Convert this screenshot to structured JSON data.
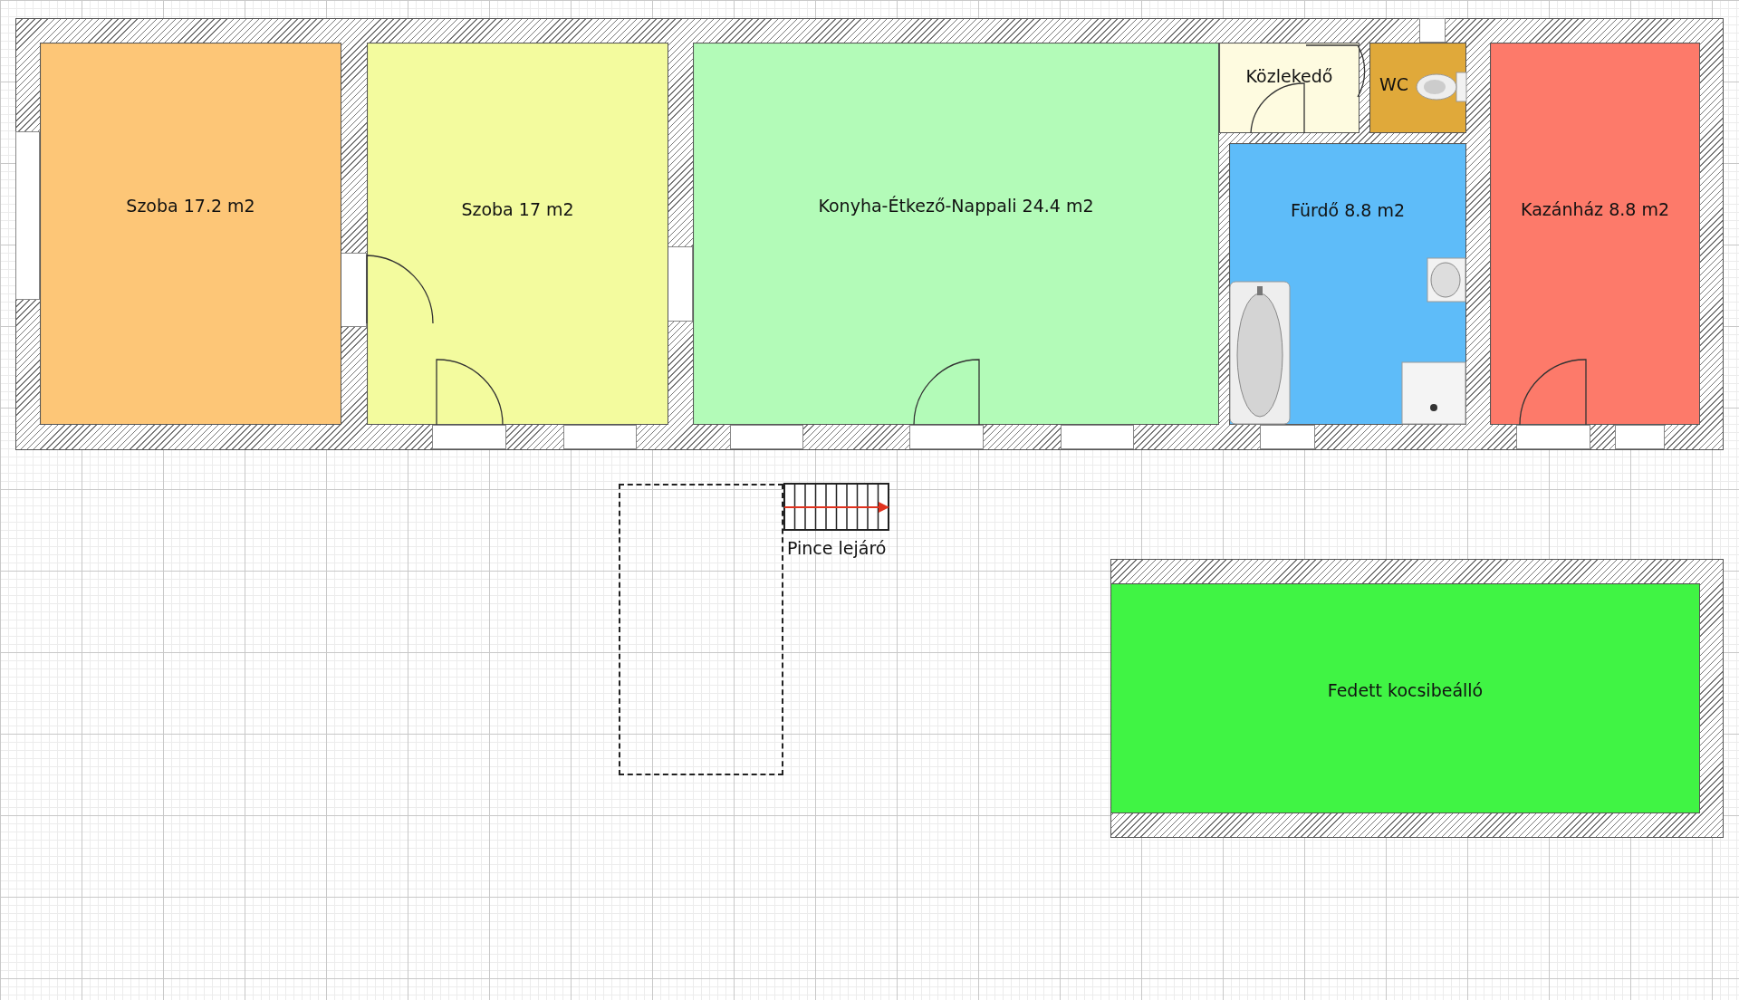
{
  "rooms": [
    {
      "label": "Szoba 17.2 m2",
      "color": "#fdc677"
    },
    {
      "label": "Szoba 17 m2",
      "color": "#f3fb9e"
    },
    {
      "label": "Konyha-Étkező-Nappali 24.4 m2",
      "color": "#b3fbb8"
    },
    {
      "label": "Közlekedő",
      "color": "#fefbe0"
    },
    {
      "label": "WC",
      "color": "#e0a93a"
    },
    {
      "label": "Fürdő 8.8 m2",
      "color": "#5ebcf9"
    },
    {
      "label": "Kazánház 8.8 m2",
      "color": "#fd7a6a"
    },
    {
      "label": "Fedett kocsibeálló",
      "color": "#40f444"
    }
  ],
  "stairs": {
    "label": "Pince lejáró"
  }
}
